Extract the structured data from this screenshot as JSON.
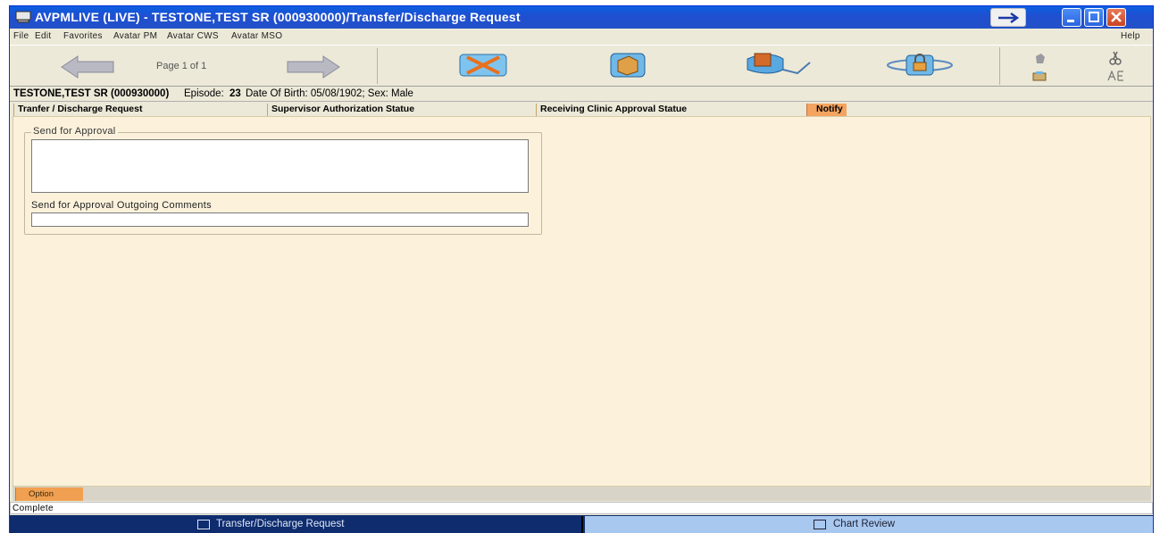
{
  "window": {
    "title": "AVPMLIVE (LIVE) - TESTONE,TEST SR (000930000)/Transfer/Discharge Request"
  },
  "menu": {
    "items": [
      "File",
      "Edit",
      "Favorites",
      "Avatar PM",
      "Avatar CWS",
      "Avatar MSO"
    ],
    "help": "Help"
  },
  "toolbar": {
    "page_label": "Page 1 of 1",
    "icons": [
      "back-arrow-icon",
      "forward-arrow-icon",
      "clear-form-icon",
      "folder-icon",
      "submit-icon",
      "lock-icon",
      "spellcheck-icon",
      "scissors-icon"
    ]
  },
  "patient": {
    "name_id": "TESTONE,TEST SR (000930000)",
    "episode_label": "Episode:",
    "episode": "23",
    "rest": "Date Of Birth: 05/08/1902; Sex: Male"
  },
  "tabs": [
    {
      "label": "Tranfer / Discharge Request"
    },
    {
      "label": "Supervisor Authorization Statue"
    },
    {
      "label": "Receiving Clinic Approval Statue"
    },
    {
      "label": "Notify"
    }
  ],
  "form": {
    "group_title": "Send for Approval",
    "comments_label": "Send for Approval Outgoing Comments",
    "approval_value": "",
    "comments_value": ""
  },
  "option_tab": "Option",
  "status": "Complete",
  "taskbar": [
    {
      "label": "Transfer/Discharge Request",
      "active": true
    },
    {
      "label": "Chart Review",
      "active": false
    }
  ],
  "colors": {
    "titlebar": "#2351c8",
    "content_bg": "#fcf2dc",
    "notify_tab": "#f4a460",
    "taskbar_active": "#0e2c6e",
    "taskbar_inactive": "#a8c8f0"
  }
}
